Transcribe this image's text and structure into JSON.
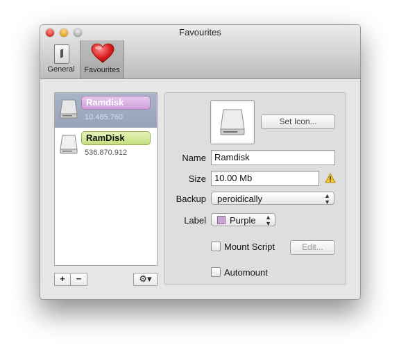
{
  "window": {
    "title": "Favourites"
  },
  "toolbar": {
    "items": [
      {
        "label": "General",
        "icon": "switch-icon"
      },
      {
        "label": "Favourites",
        "icon": "heart-icon"
      }
    ]
  },
  "list": {
    "items": [
      {
        "name": "Ramdisk",
        "size": "10.485.760",
        "label_color": "#cf9fdc",
        "selected": true
      },
      {
        "name": "RamDisk",
        "size": "536.870.912",
        "label_color": "#c6df7f",
        "selected": false
      }
    ],
    "buttons": {
      "add": "+",
      "remove": "−",
      "gear": "⚙▾"
    }
  },
  "details": {
    "set_icon": "Set Icon...",
    "name_label": "Name",
    "name_value": "Ramdisk",
    "size_label": "Size",
    "size_value": "10.00 Mb",
    "backup_label": "Backup",
    "backup_value": "peroidically",
    "label_label": "Label",
    "label_value": "Purple",
    "mount_script": "Mount Script",
    "edit": "Edit...",
    "automount": "Automount"
  }
}
